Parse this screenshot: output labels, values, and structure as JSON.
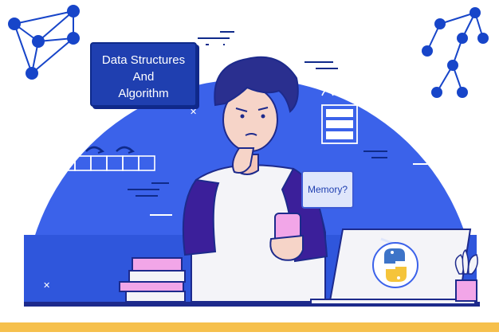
{
  "illustration": {
    "title_box": {
      "line1": "Data Structures",
      "line2": "And",
      "line3": "Algorithm"
    },
    "thought_bubble": "Memory?",
    "logo_icon": "python-logo-icon",
    "colors": {
      "background_circle": "#3b62ea",
      "dark_navy": "#1d2a8c",
      "graph_nodes": "#1745c9",
      "floor_strip": "#f6c04c",
      "phone_pink": "#f2a6e8",
      "shirt_white": "#f4f4f8"
    }
  }
}
